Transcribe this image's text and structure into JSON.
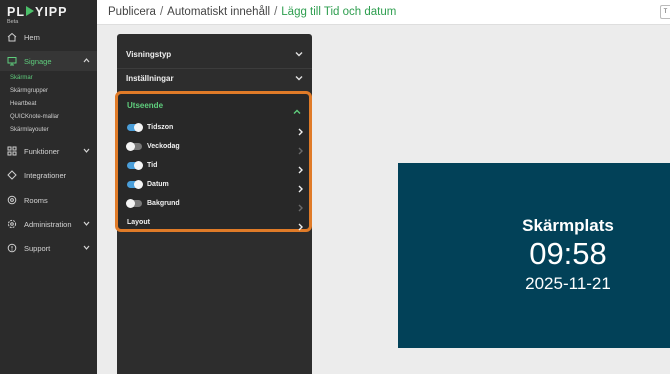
{
  "sidebar": {
    "logo_text_left": "PL",
    "logo_text_right": "YIPP",
    "logo_sub": "Beta",
    "items": [
      {
        "label": "Hem",
        "icon": "home-icon"
      },
      {
        "label": "Signage",
        "icon": "monitor-icon"
      },
      {
        "label": "Funktioner",
        "icon": "grid-icon"
      },
      {
        "label": "Integrationer",
        "icon": "diamond-icon"
      },
      {
        "label": "Rooms",
        "icon": "rooms-icon"
      },
      {
        "label": "Administration",
        "icon": "gear-icon"
      },
      {
        "label": "Support",
        "icon": "support-icon"
      }
    ],
    "subitems": [
      "Skärmar",
      "Skärmgrupper",
      "Heartbeat",
      "QUICKnote-mallar",
      "Skärmlayouter"
    ]
  },
  "breadcrumb": {
    "items": [
      "Publicera",
      "Automatiskt innehåll",
      "Lägg till Tid och datum"
    ],
    "separator": "/"
  },
  "top_button": "T",
  "panel": {
    "sections": [
      "Visningstyp",
      "Inställningar"
    ],
    "group": {
      "title": "Utseende",
      "options": [
        {
          "label": "Tidszon",
          "on": true
        },
        {
          "label": "Veckodag",
          "on": false
        },
        {
          "label": "Tid",
          "on": true
        },
        {
          "label": "Datum",
          "on": true
        },
        {
          "label": "Bakgrund",
          "on": false
        }
      ],
      "layout_label": "Layout"
    }
  },
  "preview": {
    "title": "Skärmplats",
    "time": "09:58",
    "date": "2025-11-21",
    "background": "#024158"
  },
  "colors": {
    "accent_green": "#5fce7d",
    "highlight_orange": "#e07b28",
    "toggle_on": "#4a9ed9"
  }
}
